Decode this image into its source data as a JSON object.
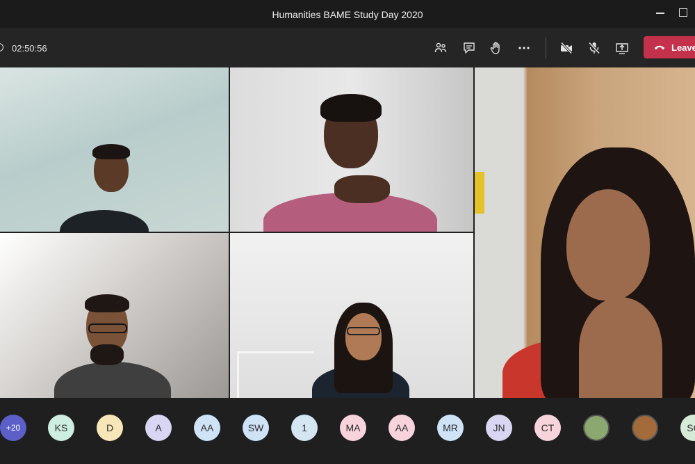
{
  "window": {
    "title": "Humanities BAME Study Day 2020"
  },
  "toolbar": {
    "timer": "02:50:56",
    "leave_label": "Leave",
    "icons": [
      "participants-icon",
      "chat-icon",
      "raise-hand-icon",
      "more-options-icon",
      "camera-off-icon",
      "mic-off-icon",
      "share-screen-icon",
      "phone-icon"
    ],
    "leave_color": "#c4314b"
  },
  "participants": [
    {
      "initials": "+20",
      "color": "#5b5fc7"
    },
    {
      "initials": "KS",
      "color": "#cdeee0"
    },
    {
      "initials": "D",
      "color": "#f7e7b8"
    },
    {
      "initials": "A",
      "color": "#d9d6f3"
    },
    {
      "initials": "AA",
      "color": "#cfe3f7"
    },
    {
      "initials": "SW",
      "color": "#cfe3f7"
    },
    {
      "initials": "1",
      "color": "#d4e6f2"
    },
    {
      "initials": "MA",
      "color": "#f7d4dc"
    },
    {
      "initials": "AA",
      "color": "#f7d4dc"
    },
    {
      "initials": "MR",
      "color": "#cfe3f7"
    },
    {
      "initials": "JN",
      "color": "#d9d6f3"
    },
    {
      "initials": "CT",
      "color": "#f7d4dc"
    },
    {
      "initials": "",
      "color": "#8aa870"
    },
    {
      "initials": "",
      "color": "#a36a3c"
    },
    {
      "initials": "SC",
      "color": "#d7ecd8"
    }
  ]
}
